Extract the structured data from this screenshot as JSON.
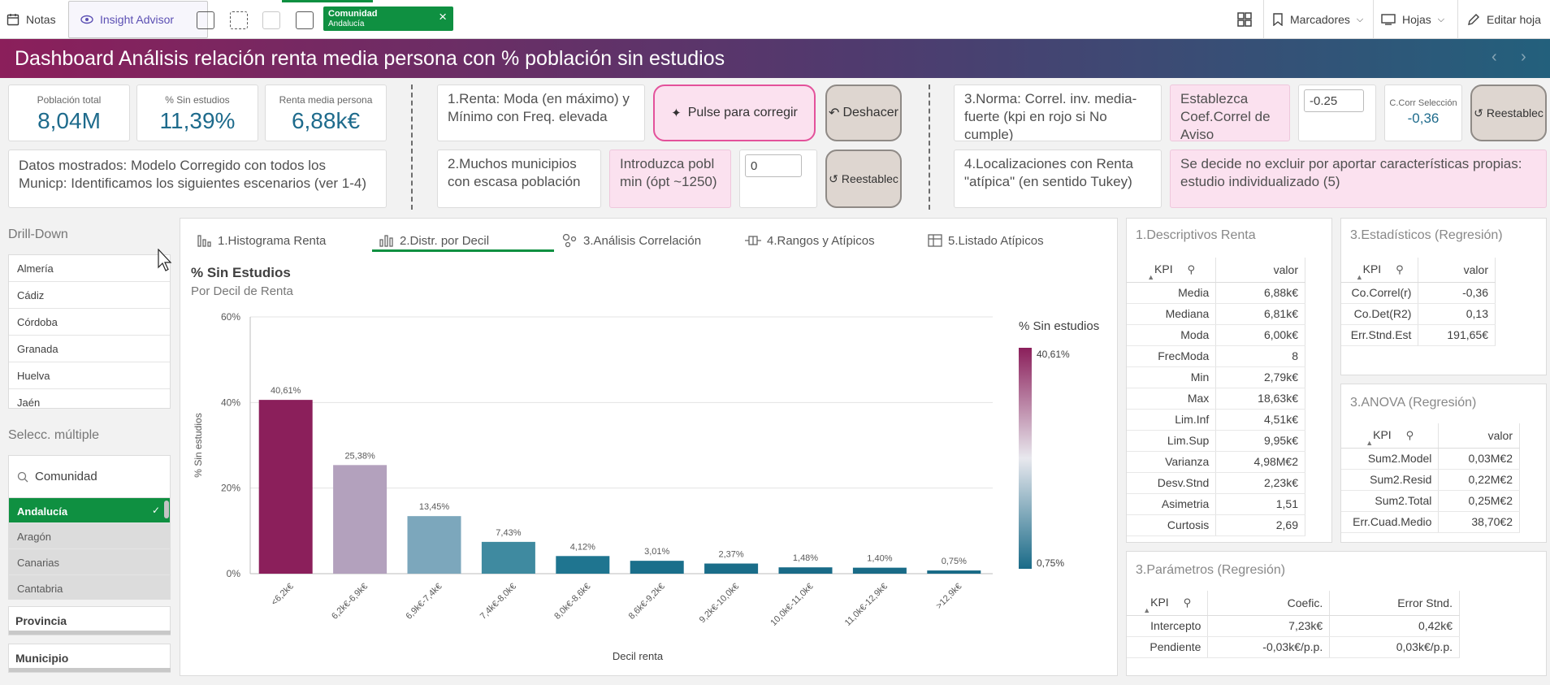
{
  "toolbar": {
    "notes": "Notas",
    "insight": "Insight Advisor",
    "bookmarks": "Marcadores",
    "sheets": "Hojas",
    "edit": "Editar hoja"
  },
  "selection": {
    "field": "Comunidad",
    "value": "Andalucía"
  },
  "title": "Dashboard Análisis relación renta media persona con % población sin estudios",
  "kpis": [
    {
      "label": "Población total",
      "value": "8,04M"
    },
    {
      "label": "% Sin estudios",
      "value": "11,39%"
    },
    {
      "label": "Renta media persona",
      "value": "6,88k€"
    }
  ],
  "info": {
    "datos": "Datos mostrados: Modelo Corregido con  todos los Municp: Identificamos los siguientes escenarios (ver 1-4)"
  },
  "scenarios": {
    "s1": "1.Renta: Moda (en máximo) y Mínimo con Freq. elevada",
    "s1_btn": "Pulse para corregir",
    "undo": "Deshacer",
    "s2": "2.Muchos municipios con escasa población",
    "s2_hint": "Introduzca pobl min (ópt ~1250)",
    "s2_value": "0",
    "reset": "Reestablec",
    "s3": "3.Norma: Correl. inv. media-fuerte (kpi en rojo si No cumple)",
    "s3_hint": "Establezca Coef.Correl de Aviso",
    "s3_value": "-0.25",
    "corr_label": "C.Corr Selección",
    "corr_value": "-0,36",
    "s4": "4.Localizaciones con Renta \"atípica\" (en sentido Tukey)",
    "s4_note": "Se decide no excluir por aportar características propias: estudio individualizado (5)"
  },
  "drill": {
    "title": "Drill-Down",
    "items": [
      "Almería",
      "Cádiz",
      "Córdoba",
      "Granada",
      "Huelva",
      "Jaén"
    ]
  },
  "multi": {
    "title": "Selecc. múltiple",
    "search": "Comunidad",
    "items": [
      "Andalucía",
      "Aragón",
      "Canarias",
      "Cantabria"
    ],
    "provincia": "Provincia",
    "municipio": "Municipio"
  },
  "tabs": [
    "1.Histograma Renta",
    "2.Distr. por Decil",
    "3.Análisis Correlación",
    "4.Rangos y Atípicos",
    "5.Listado Atípicos"
  ],
  "chart_data": {
    "type": "bar",
    "title": "% Sin Estudios",
    "subtitle": "Por Decil de Renta",
    "xlabel": "Decil renta",
    "ylabel": "% Sin estudios",
    "ylim": [
      0,
      60
    ],
    "yticks": [
      "0%",
      "20%",
      "40%",
      "60%"
    ],
    "categories": [
      "<6,2k€",
      "6,2k€-6,9k€",
      "6,9k€-7,4k€",
      "7,4k€-8,0k€",
      "8,0k€-8,6k€",
      "8,6k€-9,2k€",
      "9,2k€-10,0k€",
      "10,0k€-11,0k€",
      "11,0k€-12,9k€",
      ">12,9k€"
    ],
    "values": [
      40.61,
      25.38,
      13.45,
      7.43,
      4.12,
      3.01,
      2.37,
      1.48,
      1.4,
      0.75
    ],
    "labels": [
      "40,61%",
      "25,38%",
      "13,45%",
      "7,43%",
      "4,12%",
      "3,01%",
      "2,37%",
      "1,48%",
      "1,40%",
      "0,75%"
    ],
    "colors": [
      "#8b1f5b",
      "#b3a1bd",
      "#7ca7bc",
      "#3f8aa0",
      "#1f7590",
      "#1a6f8b",
      "#1a6d89",
      "#196b88",
      "#196b87",
      "#186a86"
    ],
    "legend": {
      "title": "% Sin estudios",
      "max": "40,61%",
      "min": "0,75%"
    },
    "grid": true
  },
  "desc": {
    "title": "1.Descriptivos Renta",
    "col1": "KPI",
    "col2": "valor",
    "rows": [
      [
        "Media",
        "6,88k€"
      ],
      [
        "Mediana",
        "6,81k€"
      ],
      [
        "Moda",
        "6,00k€"
      ],
      [
        "FrecModa",
        "8"
      ],
      [
        "Min",
        "2,79k€"
      ],
      [
        "Max",
        "18,63k€"
      ],
      [
        "Lim.Inf",
        "4,51k€"
      ],
      [
        "Lim.Sup",
        "9,95k€"
      ],
      [
        "Varianza",
        "4,98M€2"
      ],
      [
        "Desv.Stnd",
        "2,23k€"
      ],
      [
        "Asimetria",
        "1,51"
      ],
      [
        "Curtosis",
        "2,69"
      ]
    ]
  },
  "stats": {
    "title": "3.Estadísticos (Regresión)",
    "col1": "KPI",
    "col2": "valor",
    "rows": [
      [
        "Co.Correl(r)",
        "-0,36"
      ],
      [
        "Co.Det(R2)",
        "0,13"
      ],
      [
        "Err.Stnd.Est",
        "191,65€"
      ]
    ]
  },
  "anova": {
    "title": "3.ANOVA (Regresión)",
    "col1": "KPI",
    "col2": "valor",
    "rows": [
      [
        "Sum2.Model",
        "0,03M€2"
      ],
      [
        "Sum2.Resid",
        "0,22M€2"
      ],
      [
        "Sum2.Total",
        "0,25M€2"
      ],
      [
        "Err.Cuad.Medio",
        "38,70€2"
      ]
    ]
  },
  "params": {
    "title": "3.Parámetros (Regresión)",
    "col1": "KPI",
    "col2": "Coefic.",
    "col3": "Error Stnd.",
    "rows": [
      [
        "Intercepto",
        "7,23k€",
        "0,42k€"
      ],
      [
        "Pendiente",
        "-0,03k€/p.p.",
        "0,03k€/p.p."
      ]
    ]
  }
}
